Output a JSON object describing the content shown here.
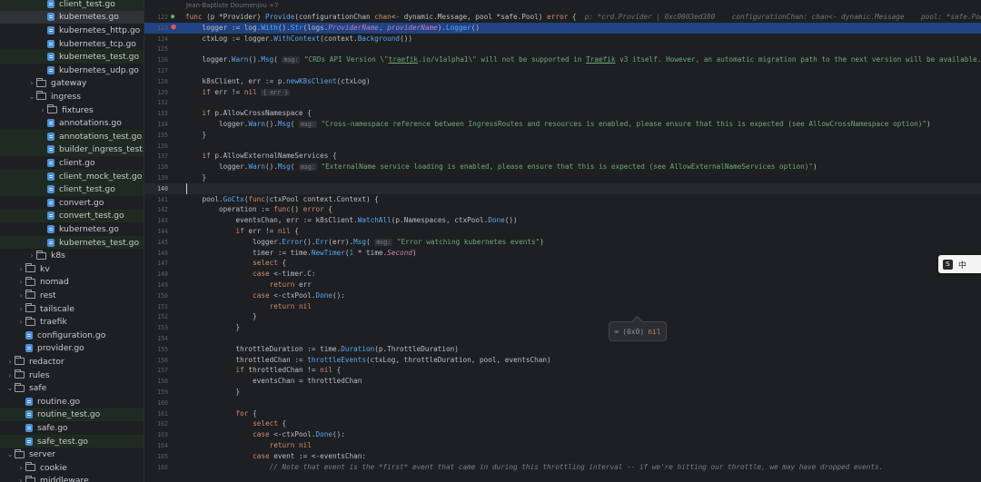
{
  "sidebar": {
    "items": [
      {
        "label": "client_test.go",
        "kind": "file",
        "indent": 3,
        "style": "test"
      },
      {
        "label": "kubernetes.go",
        "kind": "file",
        "indent": 3,
        "style": "selected"
      },
      {
        "label": "kubernetes_http.go",
        "kind": "file",
        "indent": 3,
        "style": ""
      },
      {
        "label": "kubernetes_tcp.go",
        "kind": "file",
        "indent": 3,
        "style": ""
      },
      {
        "label": "kubernetes_test.go",
        "kind": "file",
        "indent": 3,
        "style": "test"
      },
      {
        "label": "kubernetes_udp.go",
        "kind": "file",
        "indent": 3,
        "style": ""
      },
      {
        "label": "gateway",
        "kind": "folder",
        "indent": 2,
        "expanded": false,
        "style": ""
      },
      {
        "label": "ingress",
        "kind": "folder",
        "indent": 2,
        "expanded": true,
        "style": ""
      },
      {
        "label": "fixtures",
        "kind": "folder",
        "indent": 3,
        "expanded": false,
        "style": ""
      },
      {
        "label": "annotations.go",
        "kind": "file",
        "indent": 3,
        "style": ""
      },
      {
        "label": "annotations_test.go",
        "kind": "file",
        "indent": 3,
        "style": "test"
      },
      {
        "label": "builder_ingress_test.go",
        "kind": "file",
        "indent": 3,
        "style": "test"
      },
      {
        "label": "client.go",
        "kind": "file",
        "indent": 3,
        "style": ""
      },
      {
        "label": "client_mock_test.go",
        "kind": "file",
        "indent": 3,
        "style": "test"
      },
      {
        "label": "client_test.go",
        "kind": "file",
        "indent": 3,
        "style": "test"
      },
      {
        "label": "convert.go",
        "kind": "file",
        "indent": 3,
        "style": ""
      },
      {
        "label": "convert_test.go",
        "kind": "file",
        "indent": 3,
        "style": "test"
      },
      {
        "label": "kubernetes.go",
        "kind": "file",
        "indent": 3,
        "style": ""
      },
      {
        "label": "kubernetes_test.go",
        "kind": "file",
        "indent": 3,
        "style": "test"
      },
      {
        "label": "k8s",
        "kind": "folder",
        "indent": 2,
        "expanded": false,
        "style": ""
      },
      {
        "label": "kv",
        "kind": "folder",
        "indent": 1,
        "expanded": false,
        "style": ""
      },
      {
        "label": "nomad",
        "kind": "folder",
        "indent": 1,
        "expanded": false,
        "style": ""
      },
      {
        "label": "rest",
        "kind": "folder",
        "indent": 1,
        "expanded": false,
        "style": ""
      },
      {
        "label": "tailscale",
        "kind": "folder",
        "indent": 1,
        "expanded": false,
        "style": ""
      },
      {
        "label": "traefik",
        "kind": "folder",
        "indent": 1,
        "expanded": false,
        "style": ""
      },
      {
        "label": "configuration.go",
        "kind": "file",
        "indent": 1,
        "style": ""
      },
      {
        "label": "provider.go",
        "kind": "file",
        "indent": 1,
        "style": ""
      },
      {
        "label": "redactor",
        "kind": "folder",
        "indent": 0,
        "expanded": false,
        "style": ""
      },
      {
        "label": "rules",
        "kind": "folder",
        "indent": 0,
        "expanded": false,
        "style": ""
      },
      {
        "label": "safe",
        "kind": "folder",
        "indent": 0,
        "expanded": true,
        "style": ""
      },
      {
        "label": "routine.go",
        "kind": "file",
        "indent": 1,
        "style": ""
      },
      {
        "label": "routine_test.go",
        "kind": "file",
        "indent": 1,
        "style": "test"
      },
      {
        "label": "safe.go",
        "kind": "file",
        "indent": 1,
        "style": ""
      },
      {
        "label": "safe_test.go",
        "kind": "file",
        "indent": 1,
        "style": "test"
      },
      {
        "label": "server",
        "kind": "folder",
        "indent": 0,
        "expanded": true,
        "style": ""
      },
      {
        "label": "cookie",
        "kind": "folder",
        "indent": 1,
        "expanded": false,
        "style": ""
      },
      {
        "label": "middleware",
        "kind": "folder",
        "indent": 1,
        "expanded": false,
        "style": ""
      }
    ]
  },
  "editor": {
    "author": "Jean-Baptiste Doumenjou +7",
    "lines": [
      {
        "n": "122",
        "icon": "override",
        "html": "<span class='k'>func</span> (p *Provider) <span class='f'>Provide</span>(configurationChan <span class='k'>chan</span>&lt;- dynamic.Message, pool *safe.Pool) <span class='k'>error</span> {  <span class='inl'>p: *crd.Provider | 0xc0003ed380    configurationChan: chan&lt;- dynamic.Message    pool: *safe.Pool</span>"
      },
      {
        "n": "123",
        "icon": "breakpoint",
        "hl": true,
        "html": "    logger := log.<span class='f'>With</span>().<span class='f'>Str</span>(logs.<span class='pm'>ProviderName</span>, <span class='pm'>providerName</span>).<span class='f'>Logger</span>()"
      },
      {
        "n": "124",
        "html": "    ctxLog := logger.<span class='f'>WithContext</span>(context.<span class='f'>Background</span>())"
      },
      {
        "n": "125",
        "html": ""
      },
      {
        "n": "126",
        "html": "    logger.<span class='f'>Warn</span>().<span class='f'>Msg</span>( <span class='hint'>msg:</span> <span class='s'>\"CRDs API Version \\\"<span class='u'>traefik</span>.io/v1alpha1\\\" will not be supported in <span class='u'>Traefik</span> v3 itself. However, an automatic migration path to the next version will be available.\"</span>)"
      },
      {
        "n": "127",
        "html": ""
      },
      {
        "n": "128",
        "html": "    k8sClient, err := p.<span class='f'>newK8sClient</span>(ctxLog)"
      },
      {
        "n": "129",
        "html": "    <span class='k'>if</span> err != <span class='k'>nil</span> <span class='hint'>{ err }</span>"
      },
      {
        "n": "132",
        "html": ""
      },
      {
        "n": "133",
        "html": "    <span class='k'>if</span> p.AllowCrossNamespace {"
      },
      {
        "n": "134",
        "html": "        logger.<span class='f'>Warn</span>().<span class='f'>Msg</span>( <span class='hint'>msg:</span> <span class='s'>\"Cross-namespace reference between IngressRoutes and resources is enabled, please ensure that this is expected (see AllowCrossNamespace option)\"</span>)"
      },
      {
        "n": "135",
        "html": "    }"
      },
      {
        "n": "136",
        "html": ""
      },
      {
        "n": "137",
        "html": "    <span class='k'>if</span> p.AllowExternalNameServices {"
      },
      {
        "n": "138",
        "html": "        logger.<span class='f'>Warn</span>().<span class='f'>Msg</span>( <span class='hint'>msg:</span> <span class='s'>\"ExternalName service loading is enabled, please ensure that this is expected (see AllowExternalNameServices option)\"</span>)"
      },
      {
        "n": "139",
        "html": "    }"
      },
      {
        "n": "140",
        "caret": true,
        "html": ""
      },
      {
        "n": "141",
        "html": "    pool.<span class='f'>GoCtx</span>(<span class='k'>func</span>(ctxPool context.Context) {"
      },
      {
        "n": "142",
        "html": "        operation := <span class='k'>func</span>() <span class='k'>error</span> {"
      },
      {
        "n": "143",
        "html": "            eventsChan, err := k8sClient.<span class='f'>WatchAll</span>(p.Namespaces, ctxPool.<span class='f'>Done</span>())"
      },
      {
        "n": "144",
        "html": "            <span class='k'>if</span> err != <span class='k'>nil</span> {"
      },
      {
        "n": "145",
        "html": "                logger.<span class='f'>Error</span>().<span class='f'>Err</span>(err).<span class='f'>Msg</span>( <span class='hint'>msg:</span> <span class='s'>\"Error watching kubernetes events\"</span>)"
      },
      {
        "n": "146",
        "html": "                timer := time.<span class='f'>NewTimer</span>(<span class='n'>1</span> * time.<span class='pm'>Second</span>)"
      },
      {
        "n": "147",
        "html": "                <span class='k'>select</span> {"
      },
      {
        "n": "148",
        "html": "                <span class='k'>case</span> &lt;-timer.C:"
      },
      {
        "n": "149",
        "html": "                    <span class='k'>return</span> err"
      },
      {
        "n": "150",
        "html": "                <span class='k'>case</span> &lt;-ctxPool.<span class='f'>Done</span>():"
      },
      {
        "n": "151",
        "html": "                    <span class='k'>return</span> <span class='k'>nil</span>"
      },
      {
        "n": "152",
        "html": "                }"
      },
      {
        "n": "153",
        "html": "            }"
      },
      {
        "n": "154",
        "html": ""
      },
      {
        "n": "155",
        "html": "            throttleDuration := time.<span class='f'>Duration</span>(p.ThrottleDuration)"
      },
      {
        "n": "156",
        "html": "            throttledChan := <span class='f'>throttleEvents</span>(ctxLog, throttleDuration, pool, eventsChan)"
      },
      {
        "n": "157",
        "html": "            <span class='k'>if</span> throttledChan != <span class='k'>nil</span> {"
      },
      {
        "n": "158",
        "html": "                eventsChan = throttledChan"
      },
      {
        "n": "159",
        "html": "            }"
      },
      {
        "n": "160",
        "html": ""
      },
      {
        "n": "161",
        "html": "            <span class='k'>for</span> {"
      },
      {
        "n": "162",
        "html": "                <span class='k'>select</span> {"
      },
      {
        "n": "163",
        "html": "                <span class='k'>case</span> &lt;-ctxPool.<span class='f'>Done</span>():"
      },
      {
        "n": "164",
        "html": "                    <span class='k'>return</span> <span class='k'>nil</span>"
      },
      {
        "n": "165",
        "html": "                <span class='k'>case</span> event := &lt;-eventsChan:"
      },
      {
        "n": "166",
        "html": "                    <span class='c'>// Note that event is the *first* event that came in during this throttling interval -- if we're hitting our throttle, we may have dropped events.</span>"
      }
    ]
  },
  "tooltip": {
    "prefix": "(0x0)",
    "value": "nil",
    "icon": "glasses-icon"
  },
  "ime": {
    "label": "中",
    "logo": "sogou-icon"
  }
}
